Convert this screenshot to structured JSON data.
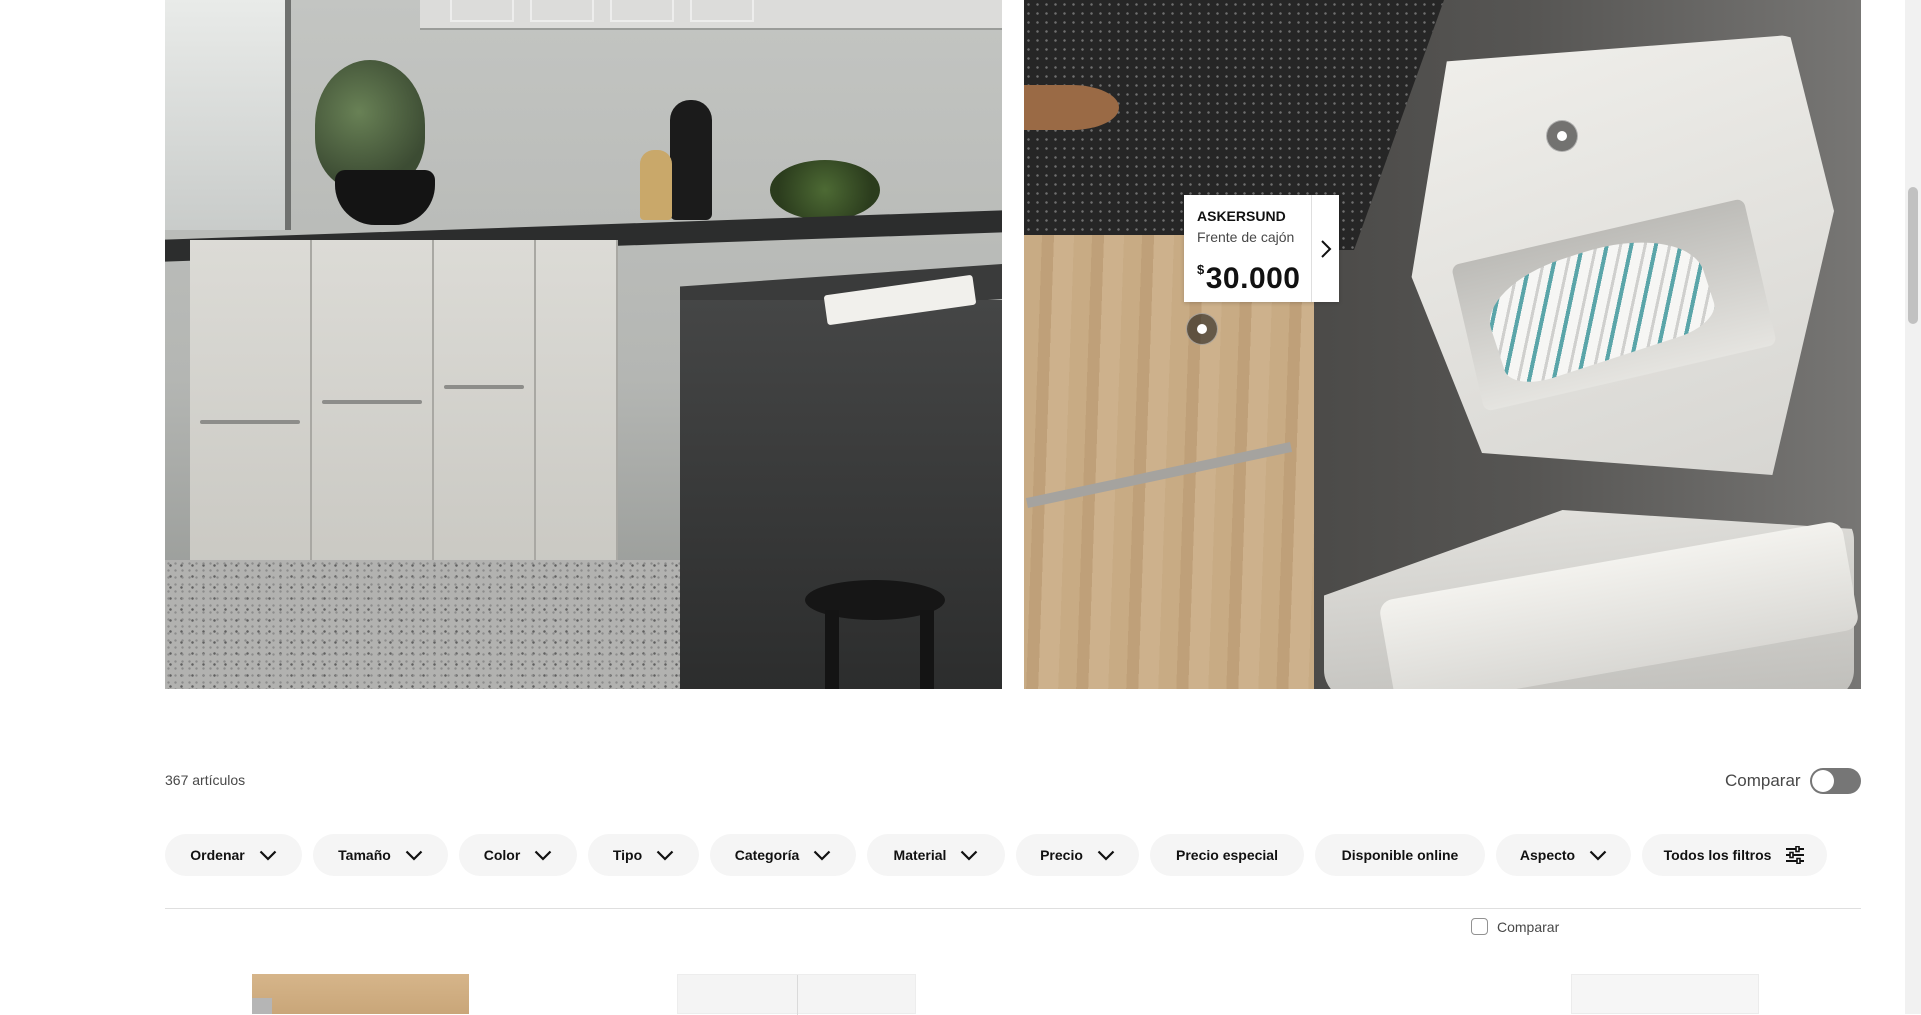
{
  "hero": {
    "left_image": "Cocina con frentes blancos y encimera negra",
    "right_image": "Cubos de reciclaje blancos junto a frente de cajón de madera"
  },
  "product_tag": {
    "name": "ASKERSUND",
    "description": "Frente de cajón",
    "currency": "$",
    "price": "30.000",
    "arrow_icon": "chevron-right-icon"
  },
  "results": {
    "count_label": "367 artículos",
    "compare_label": "Comparar",
    "compare_enabled": false
  },
  "filters": [
    {
      "label": "Ordenar",
      "icon": "chevron-down-icon"
    },
    {
      "label": "Tamaño",
      "icon": "chevron-down-icon"
    },
    {
      "label": "Color",
      "icon": "chevron-down-icon"
    },
    {
      "label": "Tipo",
      "icon": "chevron-down-icon"
    },
    {
      "label": "Categoría",
      "icon": "chevron-down-icon"
    },
    {
      "label": "Material",
      "icon": "chevron-down-icon"
    },
    {
      "label": "Precio",
      "icon": "chevron-down-icon"
    },
    {
      "label": "Precio especial",
      "icon": ""
    },
    {
      "label": "Disponible online",
      "icon": ""
    },
    {
      "label": "Aspecto",
      "icon": "chevron-down-icon"
    },
    {
      "label": "Todos los filtros",
      "icon": "filter-sliders-icon"
    }
  ],
  "product_compare": {
    "label": "Comparar",
    "checked": false
  },
  "colors": {
    "pill_bg": "#f5f5f5",
    "toggle_off": "#767676",
    "text_primary": "#111111",
    "text_secondary": "#484848"
  }
}
